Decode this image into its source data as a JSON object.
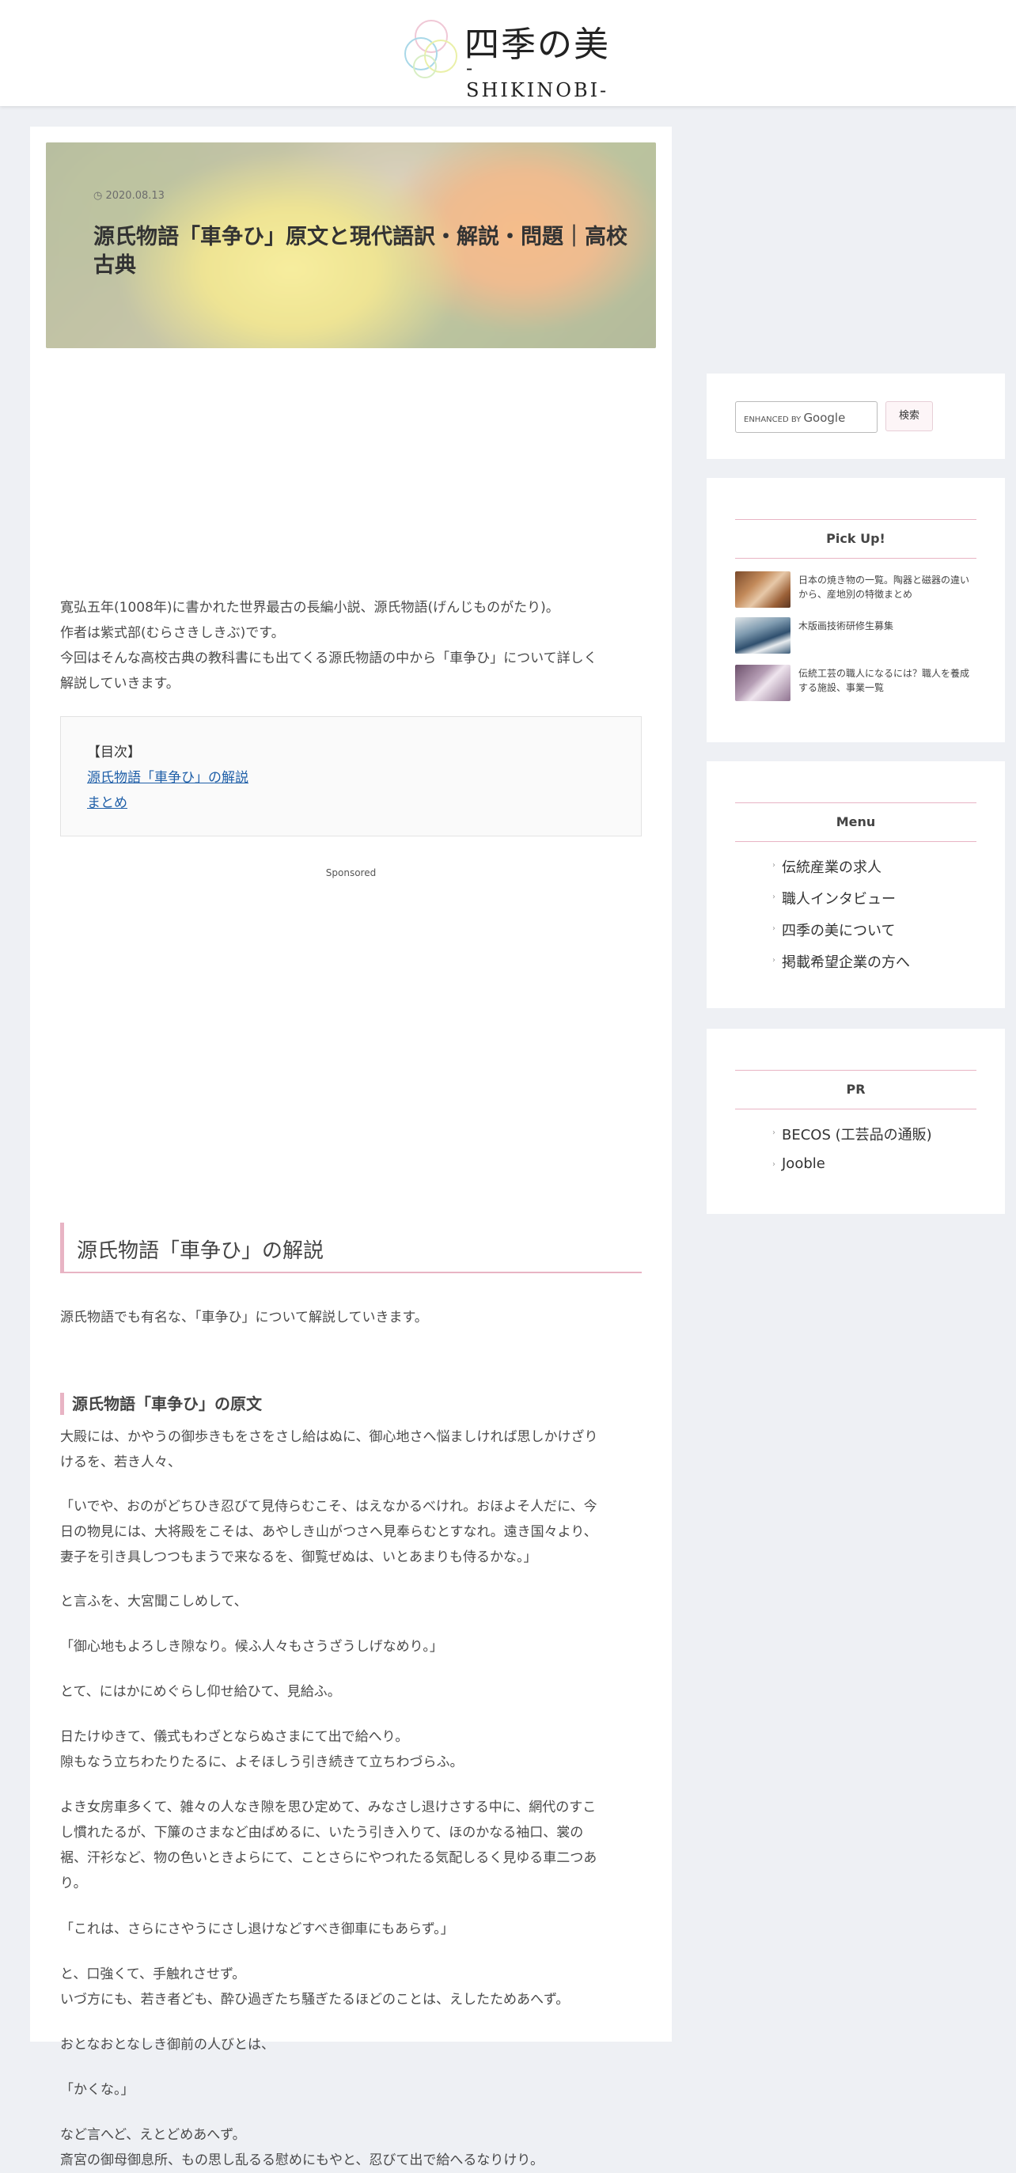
{
  "site": {
    "logo_kanji": "四季の美",
    "logo_romaji": "-SHIKINOBI-"
  },
  "article": {
    "date": "2020.08.13",
    "title": "源氏物語「車争ひ」原文と現代語訳・解説・問題｜高校古典",
    "intro": [
      "寛弘五年(1008年)に書かれた世界最古の長編小説、源氏物語(げんじものがたり)。",
      "作者は紫式部(むらさきしきぶ)です。",
      "今回はそんな高校古典の教科書にも出てくる源氏物語の中から「車争ひ」について詳しく",
      "解説していきます。"
    ],
    "toc": {
      "title": "【目次】",
      "links": [
        "源氏物語「車争ひ」の解説",
        "まとめ"
      ]
    },
    "sponsored": "Sponsored",
    "h2": "源氏物語「車争ひ」の解説",
    "h2_sub": "源氏物語でも有名な、「車争ひ」について解説していきます。",
    "h3": "源氏物語「車争ひ」の原文",
    "paragraphs": [
      [
        "大殿には、かやうの御歩きもをさをさし給はぬに、御心地さへ悩ましければ思しかけざり",
        "けるを、若き人々、"
      ],
      [
        "「いでや、おのがどちひき忍びて見侍らむこそ、はえなかるべけれ。おほよそ人だに、今",
        "日の物見には、大将殿をこそは、あやしき山がつさへ見奉らむとすなれ。遠き国々より、",
        "妻子を引き具しつつもまうで来なるを、御覧ぜぬは、いとあまりも侍るかな。」"
      ],
      [
        "と言ふを、大宮聞こしめして、"
      ],
      [
        "「御心地もよろしき隙なり。候ふ人々もさうざうしげなめり。」"
      ],
      [
        "とて、にはかにめぐらし仰せ給ひて、見給ふ。"
      ],
      [
        "日たけゆきて、儀式もわざとならぬさまにて出で給へり。",
        "隙もなう立ちわたりたるに、よそほしう引き続きて立ちわづらふ。"
      ],
      [
        "よき女房車多くて、雑々の人なき隙を思ひ定めて、みなさし退けさする中に、網代のすこ",
        "し慣れたるが、下簾のさまなど由ばめるに、いたう引き入りて、ほのかなる袖口、裳の",
        "裾、汗衫など、物の色いときよらにて、ことさらにやつれたる気配しるく見ゆる車二つあ",
        "り。"
      ],
      [
        "「これは、さらにさやうにさし退けなどすべき御車にもあらず。」"
      ],
      [
        "と、口強くて、手触れさせず。",
        "いづ方にも、若き者ども、酔ひ過ぎたち騒ぎたるほどのことは、えしたためあへず。"
      ],
      [
        "おとなおとなしき御前の人びとは、"
      ],
      [
        "「かくな。」"
      ],
      [
        "など言へど、えとどめあへず。",
        "斎宮の御母御息所、もの思し乱るる慰めにもやと、忍びて出で給へるなりけり。"
      ]
    ]
  },
  "sidebar": {
    "search": {
      "brand_small": "ENHANCED BY",
      "brand": "Google",
      "button": "検索"
    },
    "pickup": {
      "title": "Pick Up!",
      "items": [
        "日本の焼き物の一覧。陶器と磁器の違いから、産地別の特徴まとめ",
        "木版画技術研修生募集",
        "伝統工芸の職人になるには？職人を養成する施設、事業一覧"
      ]
    },
    "menu": {
      "title": "Menu",
      "items": [
        "伝統産業の求人",
        "職人インタビュー",
        "四季の美について",
        "掲載希望企業の方へ"
      ]
    },
    "pr": {
      "title": "PR",
      "items": [
        "BECOS (工芸品の通販)",
        "Jooble"
      ]
    }
  },
  "icons": {
    "clock": "clock-icon",
    "chevron": "chevron-right-icon"
  },
  "colors": {
    "accent_pink": "#e8b4c4",
    "link_blue": "#1f5fa8",
    "background": "#eef0f4"
  }
}
